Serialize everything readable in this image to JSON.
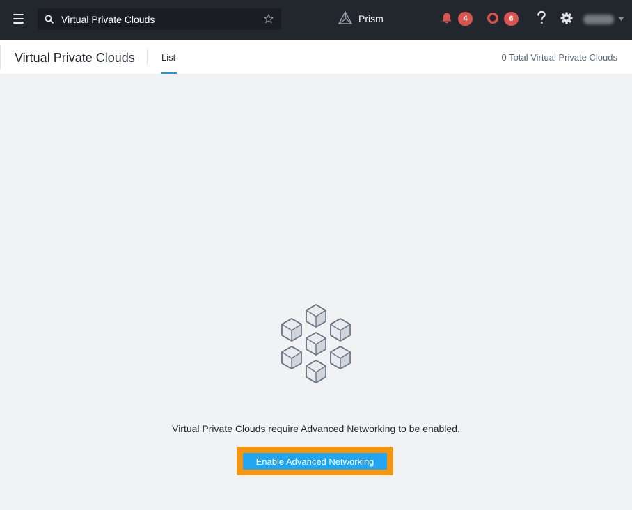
{
  "header": {
    "search": {
      "value": "Virtual Private Clouds",
      "placeholder": ""
    },
    "brand_label": "Prism",
    "alerts_count": "4",
    "events_count": "6",
    "icons": [
      "menu-icon",
      "search-icon",
      "star-icon",
      "prism-logo-icon",
      "bell-icon",
      "ring-icon",
      "help-icon",
      "gear-icon",
      "chevron-down-icon"
    ]
  },
  "subheader": {
    "title": "Virtual Private Clouds",
    "tabs": [
      {
        "label": "List",
        "active": true
      }
    ],
    "total": "0 Total Virtual Private Clouds"
  },
  "empty_state": {
    "illustration": "hexagonal-cubes-icon",
    "message": "Virtual Private Clouds require Advanced Networking to be enabled.",
    "button_label": "Enable Advanced Networking"
  },
  "colors": {
    "topbar": "#22272e",
    "badge": "#d9534f",
    "accent": "#1b9bde",
    "button": "#22a5f0",
    "highlight": "#f6950f",
    "page_background": "#f1f2f4"
  }
}
